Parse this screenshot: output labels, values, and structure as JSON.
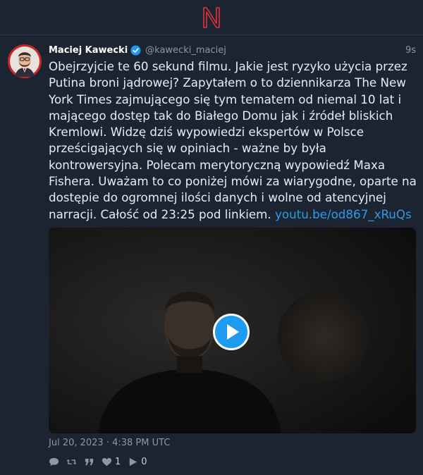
{
  "app": {
    "logo": "N-logo-icon",
    "accent": "#e0333e"
  },
  "tweet": {
    "author_name": "Maciej Kawecki",
    "author_handle": "@kawecki_maciej",
    "verified": true,
    "relative_time": "9s",
    "text_before_link": "Obejrzyjcie te 60 sekund filmu. Jakie jest ryzyko użycia przez Putina broni jądrowej? Zapytałem o to dziennikarza The New York Times zajmującego się tym tematem od niemal 10 lat i mającego dostęp tak do Białego Domu jak i źródeł bliskich Kremlowi. Widzę dziś wypowiedzi ekspertów w Polsce prześcigających się w opiniach - ważne by była kontrowersyjna. Polecam merytoryczną wypowiedź Maxa Fishera. Uważam to co poniżej mówi za wiarygodne, oparte na dostępie do ogromnej ilości danych i wolne od atencyjnej narracji. Całość od 23:25 pod linkiem. ",
    "link_text": "youtu.be/od867_xRuQs",
    "link_color": "#2e9ce6",
    "date": "Jul 20, 2023 · 4:38 PM UTC",
    "media": {
      "type": "video",
      "play_icon": "play-icon"
    },
    "actions": {
      "reply": {
        "icon": "reply-icon"
      },
      "retweet": {
        "icon": "retweet-icon"
      },
      "quote": {
        "icon": "quote-icon"
      },
      "like": {
        "icon": "heart-icon",
        "count": "1"
      },
      "play": {
        "icon": "play-count-icon",
        "count": "0"
      }
    }
  }
}
